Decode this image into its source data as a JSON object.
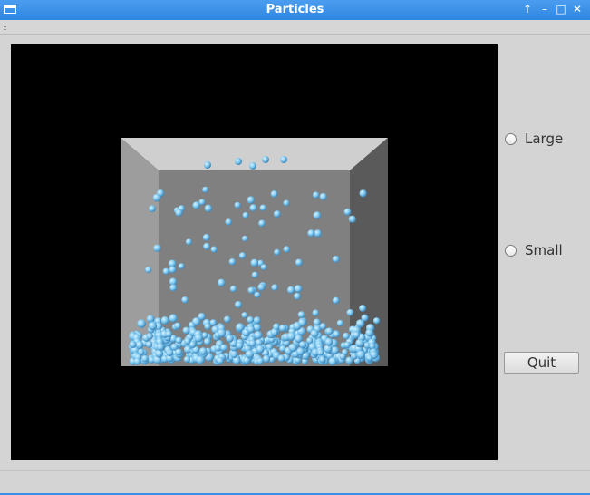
{
  "window": {
    "title": "Particles"
  },
  "titlebar_buttons": [
    "↑",
    "–",
    "□",
    "✕"
  ],
  "controls": {
    "large_label": "Large",
    "small_label": "Small",
    "quit_label": "Quit",
    "large_selected": false,
    "small_selected": false
  },
  "colors": {
    "titlebar": "#3a8ee6",
    "viewport_bg": "#000000",
    "box_back": "#808080",
    "box_top": "#cfcfcf",
    "box_left": "#9d9d9d",
    "box_right": "#5a5a5a",
    "particle": "#7ec8f0"
  }
}
